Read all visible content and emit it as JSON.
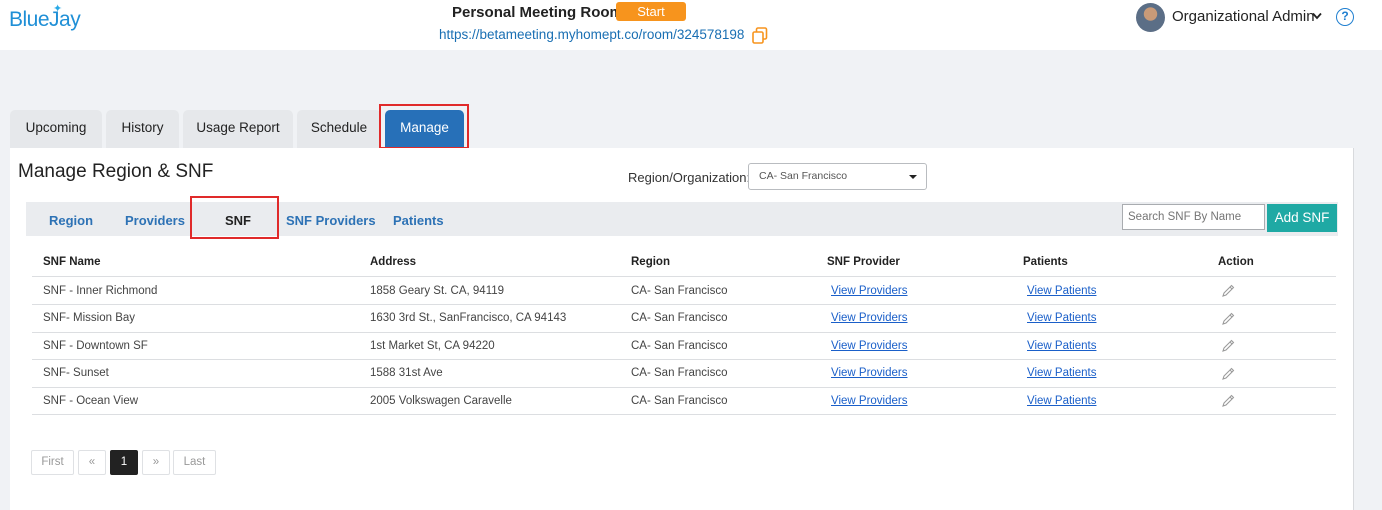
{
  "header": {
    "logo": "BlueJay",
    "meeting_label": "Personal Meeting Room:",
    "start_label": "Start",
    "room_url": "https://betameeting.myhomept.co/room/324578198",
    "user_name": "Organizational Admin",
    "help": "?"
  },
  "main_tabs": [
    {
      "label": "Upcoming"
    },
    {
      "label": "History"
    },
    {
      "label": "Usage Report"
    },
    {
      "label": "Schedule"
    },
    {
      "label": "Manage"
    }
  ],
  "page": {
    "title": "Manage Region & SNF",
    "region_label": "Region/Organization:",
    "region_value": "CA- San Francisco"
  },
  "sub_tabs": [
    {
      "label": "Region"
    },
    {
      "label": "Providers"
    },
    {
      "label": "SNF"
    },
    {
      "label": "SNF Providers"
    },
    {
      "label": "Patients"
    }
  ],
  "search": {
    "placeholder": "Search SNF By Name"
  },
  "add_label": "Add SNF",
  "table": {
    "columns": [
      "SNF Name",
      "Address",
      "Region",
      "SNF Provider",
      "Patients",
      "Action"
    ],
    "rows": [
      {
        "name": "SNF - Inner Richmond",
        "address": "1858 Geary St. CA, 94119",
        "region": "CA- San Francisco",
        "provider": "View Providers",
        "patients": "View Patients"
      },
      {
        "name": "SNF- Mission Bay",
        "address": "1630 3rd St., SanFrancisco, CA 94143",
        "region": "CA- San Francisco",
        "provider": "View Providers",
        "patients": "View Patients"
      },
      {
        "name": "SNF - Downtown SF",
        "address": "1st Market St, CA 94220",
        "region": "CA- San Francisco",
        "provider": "View Providers",
        "patients": "View Patients"
      },
      {
        "name": "SNF- Sunset",
        "address": "1588 31st Ave",
        "region": "CA- San Francisco",
        "provider": "View Providers",
        "patients": "View Patients"
      },
      {
        "name": "SNF - Ocean View",
        "address": "2005 Volkswagen Caravelle",
        "region": "CA- San Francisco",
        "provider": "View Providers",
        "patients": "View Patients"
      }
    ]
  },
  "pagination": {
    "first": "First",
    "prev": "«",
    "current": "1",
    "next": "»",
    "last": "Last"
  },
  "colors": {
    "accent": "#2770b8",
    "start": "#f7941d",
    "add": "#1fa9a4",
    "highlight": "#e02a2a"
  }
}
